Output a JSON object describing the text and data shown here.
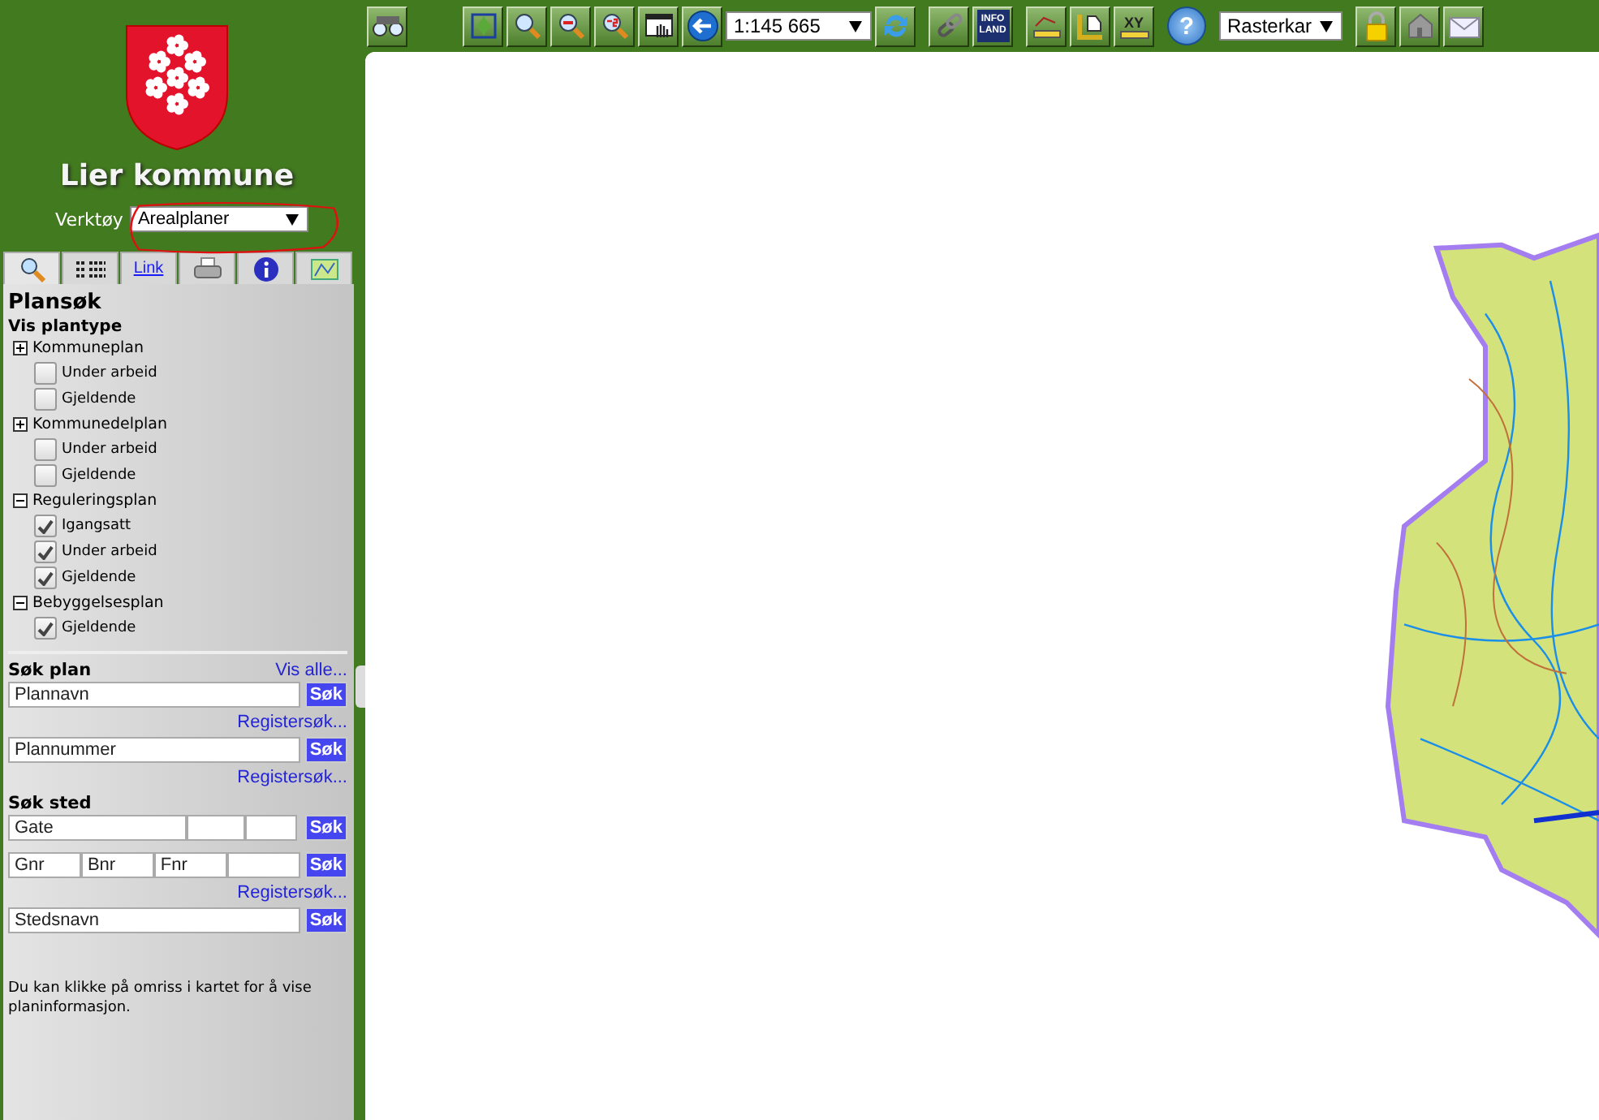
{
  "header": {
    "title": "Lier kommune",
    "tool_label": "Verktøy",
    "tool_value": "Arealplaner"
  },
  "tabs": [
    {
      "kind": "search",
      "selected": true
    },
    {
      "kind": "legend",
      "selected": false
    },
    {
      "kind": "link",
      "label": "Link",
      "selected": false
    },
    {
      "kind": "print",
      "selected": false
    },
    {
      "kind": "info",
      "selected": false
    },
    {
      "kind": "map",
      "selected": false
    }
  ],
  "panel": {
    "title": "Plansøk",
    "filter_heading": "Vis plantype",
    "groups": [
      {
        "label": "Kommuneplan",
        "expanded": false,
        "options": [
          {
            "label": "Under arbeid",
            "checked": false
          },
          {
            "label": "Gjeldende",
            "checked": false
          }
        ]
      },
      {
        "label": "Kommunedelplan",
        "expanded": false,
        "options": [
          {
            "label": "Under arbeid",
            "checked": false
          },
          {
            "label": "Gjeldende",
            "checked": false
          }
        ]
      },
      {
        "label": "Reguleringsplan",
        "expanded": true,
        "options": [
          {
            "label": "Igangsatt",
            "checked": true
          },
          {
            "label": "Under arbeid",
            "checked": true
          },
          {
            "label": "Gjeldende",
            "checked": true
          }
        ]
      },
      {
        "label": "Bebyggelsesplan",
        "expanded": true,
        "options": [
          {
            "label": "Gjeldende",
            "checked": true
          }
        ]
      }
    ],
    "sections": [
      {
        "heading": "Søk plan",
        "link": "Vis alle...",
        "rows": [
          {
            "kind": "single",
            "placeholders": [
              "Plannavn"
            ],
            "button": "Søk",
            "link": "Registersøk..."
          },
          {
            "kind": "single",
            "placeholders": [
              "Plannummer"
            ],
            "button": "Søk",
            "link": "Registersøk..."
          }
        ]
      },
      {
        "heading": "Søk sted",
        "rows": [
          {
            "kind": "address",
            "placeholders": [
              "Gate"
            ],
            "button": "Søk"
          },
          {
            "kind": "cadastre",
            "placeholders": [
              "Gnr",
              "Bnr",
              "Fnr"
            ],
            "button": "Søk",
            "link": "Registersøk..."
          },
          {
            "kind": "single",
            "placeholders": [
              "Stedsnavn"
            ],
            "button": "Søk"
          }
        ]
      }
    ],
    "note": "Du kan klikke på omriss i kartet for å vise planinformasjon."
  },
  "toolbar": {
    "groups": [
      [
        {
          "kind": "binoculars"
        }
      ],
      [
        {
          "kind": "extent"
        },
        {
          "kind": "zoom_in"
        },
        {
          "kind": "zoom_out"
        },
        {
          "kind": "zoom_step"
        },
        {
          "kind": "pan"
        },
        {
          "kind": "back"
        },
        {
          "kind": "select",
          "value": "1:145 665"
        },
        {
          "kind": "refresh"
        }
      ],
      [
        {
          "kind": "chain"
        },
        {
          "kind": "badge",
          "label": "INFO LAND"
        }
      ],
      [
        {
          "kind": "distance"
        },
        {
          "kind": "area"
        },
        {
          "kind": "coordinate",
          "label": "XY"
        }
      ],
      [
        {
          "kind": "help",
          "label": "?"
        }
      ],
      [
        {
          "kind": "select",
          "value": "Rasterkar"
        }
      ],
      [
        {
          "kind": "lock"
        },
        {
          "kind": "house"
        },
        {
          "kind": "mail"
        }
      ]
    ]
  }
}
